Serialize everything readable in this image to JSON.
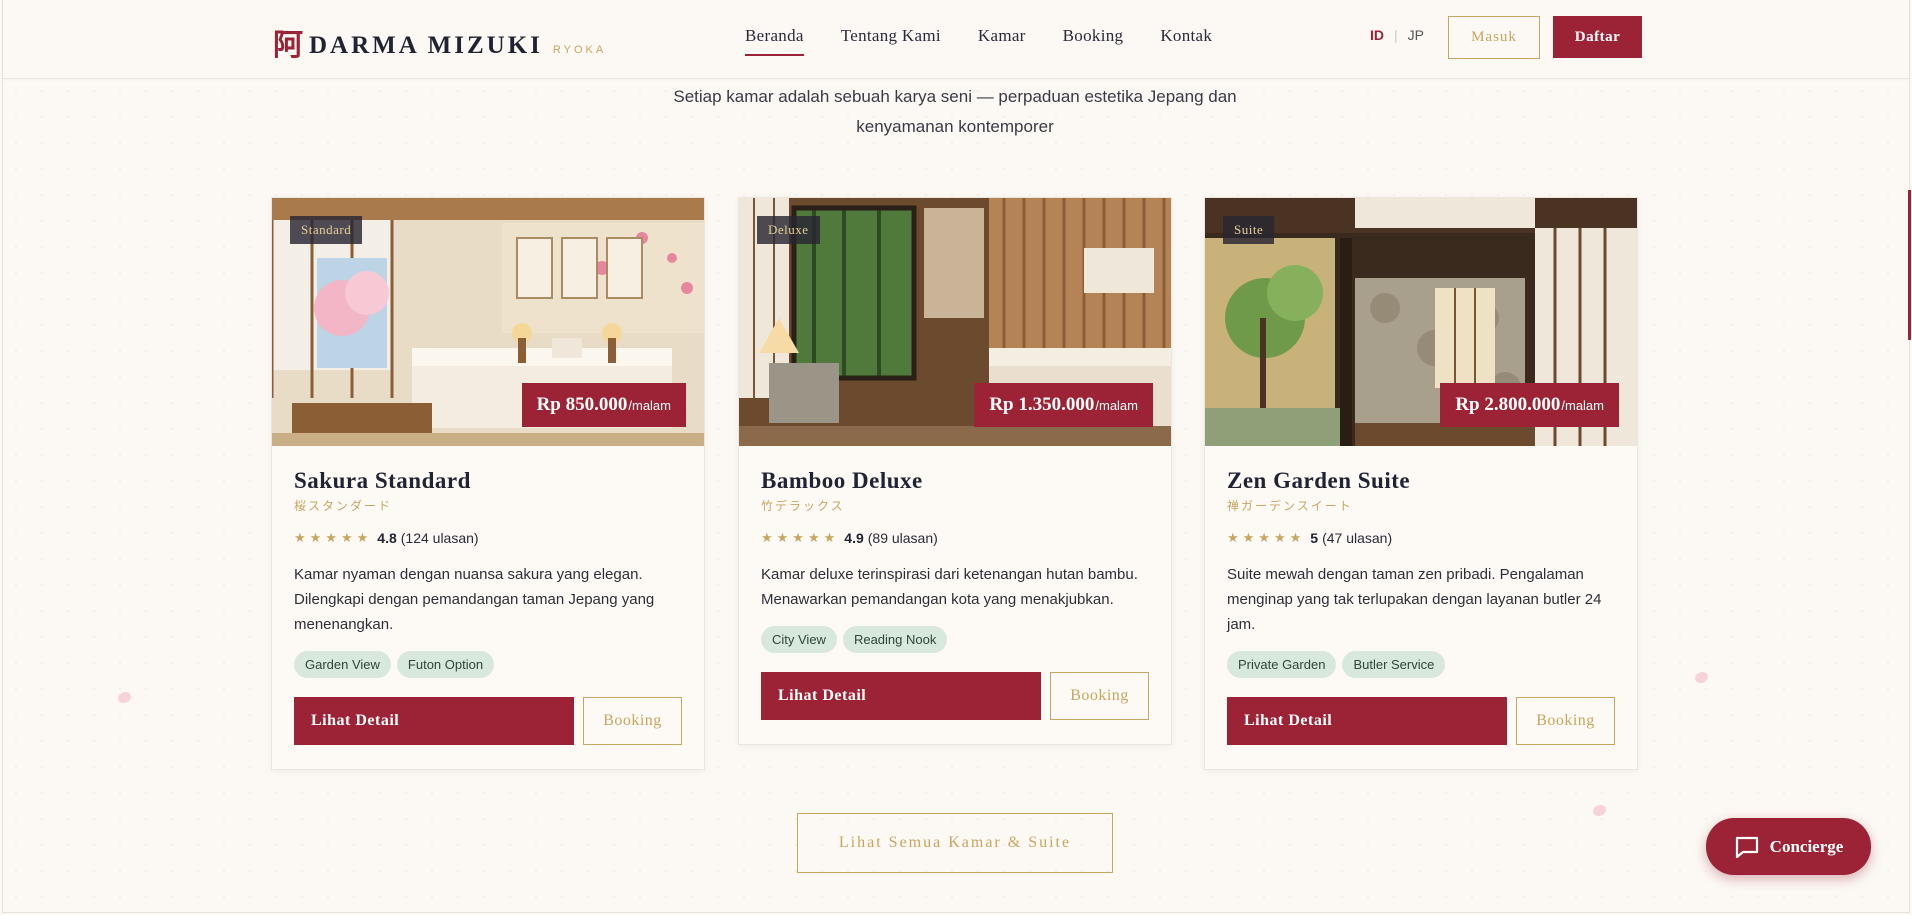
{
  "brand": {
    "mark": "阿",
    "name": "DARMA MIZUKI",
    "sub": "RYOKA"
  },
  "nav": {
    "items": [
      {
        "label": "Beranda",
        "active": true
      },
      {
        "label": "Tentang Kami",
        "active": false
      },
      {
        "label": "Kamar",
        "active": false
      },
      {
        "label": "Booking",
        "active": false
      },
      {
        "label": "Kontak",
        "active": false
      }
    ]
  },
  "lang": {
    "id": "ID",
    "sep": "|",
    "jp": "JP"
  },
  "auth": {
    "login": "Masuk",
    "register": "Daftar"
  },
  "intro": {
    "line1": "Setiap kamar adalah sebuah karya seni — perpaduan estetika Jepang dan",
    "line2": "kenyamanan kontemporer"
  },
  "rooms": [
    {
      "badge": "Standard",
      "price": "Rp 850.000",
      "unit": "/malam",
      "name": "Sakura Standard",
      "jp": "桜スタンダード",
      "stars": "★★★★★",
      "score": "4.8",
      "reviews": "(124 ulasan)",
      "desc": "Kamar nyaman dengan nuansa sakura yang elegan. Dilengkapi dengan pemandangan taman Jepang yang menenangkan.",
      "tags": [
        "Garden View",
        "Futon Option"
      ],
      "detail": "Lihat Detail",
      "book": "Booking"
    },
    {
      "badge": "Deluxe",
      "price": "Rp 1.350.000",
      "unit": "/malam",
      "name": "Bamboo Deluxe",
      "jp": "竹デラックス",
      "stars": "★★★★★",
      "score": "4.9",
      "reviews": "(89 ulasan)",
      "desc": "Kamar deluxe terinspirasi dari ketenangan hutan bambu. Menawarkan pemandangan kota yang menakjubkan.",
      "tags": [
        "City View",
        "Reading Nook"
      ],
      "detail": "Lihat Detail",
      "book": "Booking"
    },
    {
      "badge": "Suite",
      "price": "Rp 2.800.000",
      "unit": "/malam",
      "name": "Zen Garden Suite",
      "jp": "禅ガーデンスイート",
      "stars": "★★★★★",
      "score": "5",
      "reviews": "(47 ulasan)",
      "desc": "Suite mewah dengan taman zen pribadi. Pengalaman menginap yang tak terlupakan dengan layanan butler 24 jam.",
      "tags": [
        "Private Garden",
        "Butler Service"
      ],
      "detail": "Lihat Detail",
      "book": "Booking"
    }
  ],
  "all_rooms": "Lihat Semua Kamar & Suite",
  "concierge": "Concierge",
  "colors": {
    "primary": "#9b2335",
    "gold": "#c8a560",
    "bg": "#fcf9f4",
    "tag": "#d8e8dc"
  }
}
